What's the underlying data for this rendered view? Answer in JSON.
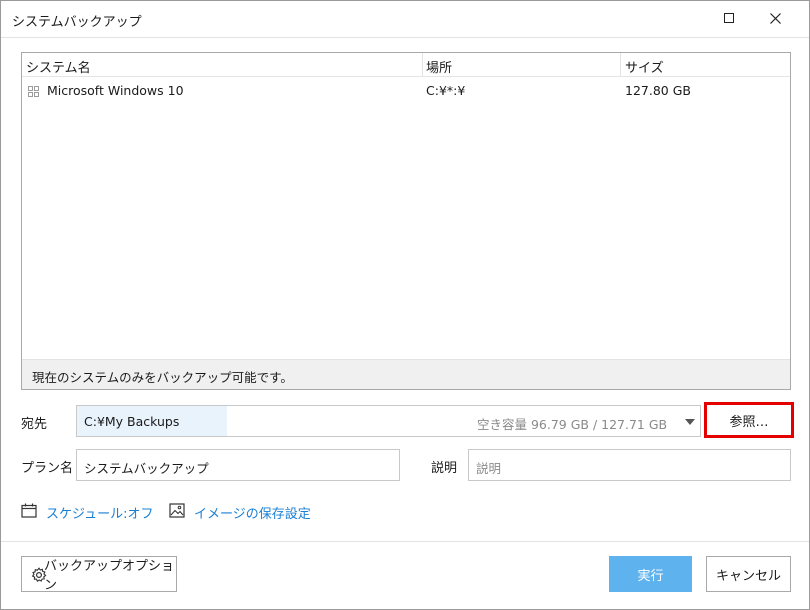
{
  "window": {
    "title": "システムバックアップ"
  },
  "list": {
    "columns": [
      "システム名",
      "場所",
      "サイズ"
    ],
    "rows": [
      {
        "name": "Microsoft Windows 10",
        "location": "C:¥*:¥",
        "size": "127.80 GB",
        "icon": "windows-icon"
      }
    ],
    "footer_note": "現在のシステムのみをバックアップ可能です。"
  },
  "destination": {
    "label": "宛先",
    "path": "C:¥My Backups",
    "free_space": "空き容量 96.79 GB / 127.71 GB",
    "browse_label": "参照…"
  },
  "plan": {
    "label": "プラン名",
    "value": "システムバックアップ"
  },
  "description": {
    "label": "説明",
    "placeholder": "説明"
  },
  "links": {
    "schedule": "スケジュール:オフ",
    "image_settings": "イメージの保存設定"
  },
  "buttons": {
    "options": "バックアップオプション",
    "run": "実行",
    "cancel": "キャンセル"
  },
  "colors": {
    "accent": "#1b7fd4",
    "run_button": "#5eb2ee",
    "highlight_box": "#e50000"
  }
}
